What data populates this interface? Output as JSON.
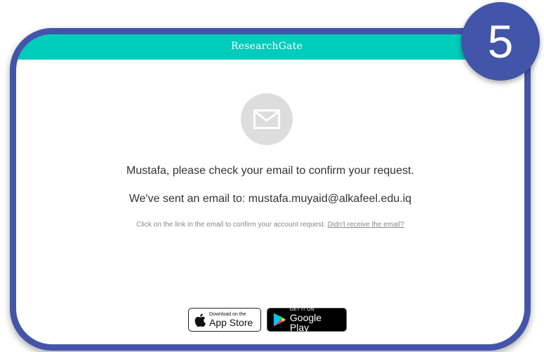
{
  "header": {
    "brand": "ResearchGate"
  },
  "step_badge": "5",
  "message": {
    "confirm_request": "Mustafa, please check your email to confirm your request.",
    "sent_to_prefix": "We've sent an email to: ",
    "email": "mustafa.muyaid@alkafeel.edu.iq",
    "instruction": "Click on the link in the email to confirm your account request.",
    "resend_link": "Didn't receive the email?"
  },
  "stores": {
    "appstore_small": "Download on the",
    "appstore_big": "App Store",
    "googleplay_small": "GET IT ON",
    "googleplay_big": "Google Play"
  },
  "colors": {
    "frame": "#4255a8",
    "header": "#00ccbb",
    "mail_circle": "#dddddd"
  },
  "icons": {
    "mail": "envelope-icon",
    "apple": "apple-icon",
    "google_play": "google-play-icon"
  }
}
